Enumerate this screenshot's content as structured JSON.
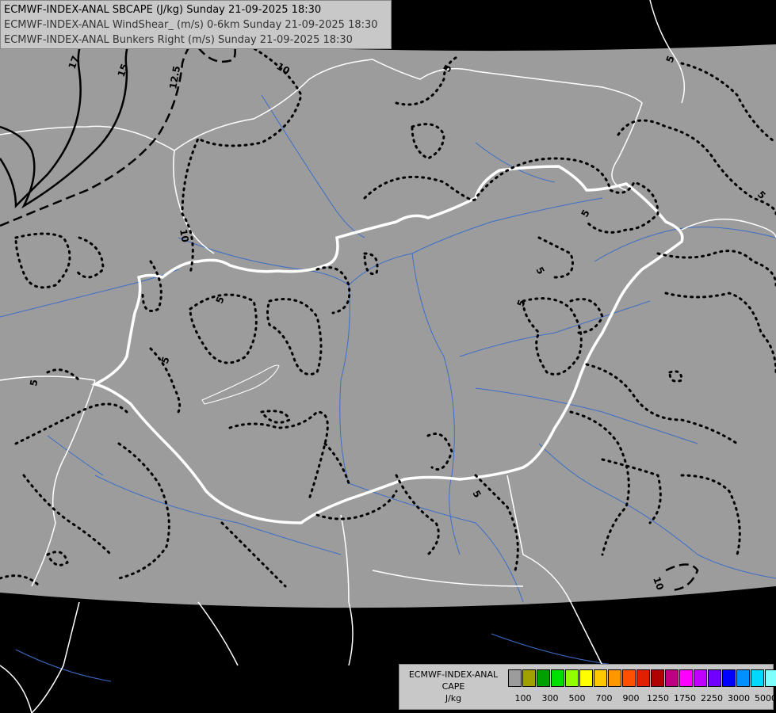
{
  "header": {
    "line1": "ECMWF-INDEX-ANAL SBCAPE (J/kg) Sunday 21-09-2025 18:30",
    "line2": "ECMWF-INDEX-ANAL WindShear_ (m/s) 0-6km Sunday 21-09-2025 18:30",
    "line3": "ECMWF-INDEX-ANAL Bunkers Right (m/s) Sunday 21-09-2025 18:30"
  },
  "legend": {
    "title1": "ECMWF-INDEX-ANAL",
    "title2": "CAPE",
    "unit": "J/kg",
    "colors": [
      "#9c9c9c",
      "#a0a000",
      "#00a000",
      "#00e000",
      "#90ff00",
      "#ffff00",
      "#ffc800",
      "#ff9600",
      "#ff5000",
      "#e02000",
      "#b00000",
      "#c00080",
      "#ff00ff",
      "#c000ff",
      "#7000ff",
      "#0000ff",
      "#0090ff",
      "#00d8ff",
      "#80ffff",
      "#ffffff"
    ],
    "tick_labels": [
      "100",
      "300",
      "500",
      "700",
      "900",
      "1250",
      "1750",
      "2250",
      "3000",
      "5000"
    ]
  },
  "contour_labels": [
    "17",
    "15",
    "12.5",
    "10",
    "10",
    "5",
    "5",
    "5",
    "5",
    "5",
    "5",
    "5",
    "5",
    "5",
    "5",
    "10"
  ],
  "colors": {
    "background": "#000000",
    "data_area": "#9c9c9c",
    "borders": "#ffffff",
    "rivers": "#3c6ec8",
    "contours": "#000000"
  }
}
